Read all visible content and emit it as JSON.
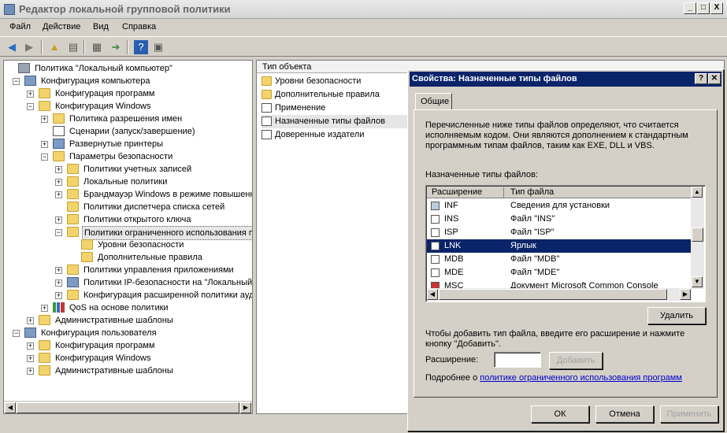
{
  "window": {
    "title": "Редактор локальной групповой политики",
    "buttons": [
      "_",
      "□",
      "X"
    ]
  },
  "menu": [
    "Файл",
    "Действие",
    "Вид",
    "Справка"
  ],
  "tree": [
    {
      "label": "Политика \"Локальный компьютер\"",
      "icon": "shield-icon"
    },
    {
      "label": "Конфигурация компьютера",
      "icon": "computer-icon"
    },
    {
      "label": "Конфигурация программ",
      "icon": "folder-icon"
    },
    {
      "label": "Конфигурация Windows",
      "icon": "folder-icon"
    },
    {
      "label": "Политика разрешения имен",
      "icon": "folder-icon"
    },
    {
      "label": "Сценарии (запуск/завершение)",
      "icon": "document-icon"
    },
    {
      "label": "Развернутые принтеры",
      "icon": "printer-icon"
    },
    {
      "label": "Параметры безопасности",
      "icon": "lock-icon"
    },
    {
      "label": "Политики учетных записей",
      "icon": "folder-icon"
    },
    {
      "label": "Локальные политики",
      "icon": "folder-icon"
    },
    {
      "label": "Брандмауэр Windows в режиме повышенн",
      "icon": "folder-icon"
    },
    {
      "label": "Политики диспетчера списка сетей",
      "icon": "folder-icon"
    },
    {
      "label": "Политики открытого ключа",
      "icon": "folder-icon"
    },
    {
      "label": "Политики ограниченного использования п",
      "icon": "folder-icon"
    },
    {
      "label": "Уровни безопасности",
      "icon": "folder-icon"
    },
    {
      "label": "Дополнительные правила",
      "icon": "folder-icon"
    },
    {
      "label": "Политики управления приложениями",
      "icon": "folder-icon"
    },
    {
      "label": "Политики IP-безопасности на \"Локальный",
      "icon": "network-icon"
    },
    {
      "label": "Конфигурация расширенной политики ауд",
      "icon": "folder-icon"
    },
    {
      "label": "QoS на основе политики",
      "icon": "chart-icon"
    },
    {
      "label": "Административные шаблоны",
      "icon": "folder-icon"
    },
    {
      "label": "Конфигурация пользователя",
      "icon": "user-icon"
    },
    {
      "label": "Конфигурация программ",
      "icon": "folder-icon"
    },
    {
      "label": "Конфигурация Windows",
      "icon": "folder-icon"
    },
    {
      "label": "Административные шаблоны",
      "icon": "folder-icon"
    }
  ],
  "list": {
    "header": "Тип объекта",
    "items": [
      "Уровни безопасности",
      "Дополнительные правила",
      "Применение",
      "Назначенные типы файлов",
      "Доверенные издатели"
    ]
  },
  "dialog": {
    "title": "Свойства: Назначенные типы файлов",
    "tab": "Общие",
    "description": "Перечисленные ниже типы файлов определяют, что считается исполняемым кодом. Они являются дополнением к стандартным программным типам файлов, таким как EXE, DLL и VBS.",
    "table_label": "Назначенные типы файлов:",
    "columns": [
      "Расширение",
      "Тип файла"
    ],
    "rows": [
      [
        "INF",
        "Сведения для установки"
      ],
      [
        "INS",
        "Файл \"INS\""
      ],
      [
        "ISP",
        "Файл \"ISP\""
      ],
      [
        "LNK",
        "Ярлык"
      ],
      [
        "MDB",
        "Файл \"MDB\""
      ],
      [
        "MDE",
        "Файл \"MDE\""
      ],
      [
        "MSC",
        "Документ Microsoft Common Console"
      ]
    ],
    "delete": "Удалить",
    "add_hint": "Чтобы добавить тип файла, введите его расширение и нажмите кнопку \"Добавить\".",
    "ext_label": "Расширение:",
    "ext_value": "",
    "add": "Добавить",
    "more_prefix": "Подробнее о",
    "more_link": "политике ограниченного использования программ",
    "ok": "ОК",
    "cancel": "Отмена",
    "apply": "Применить"
  }
}
